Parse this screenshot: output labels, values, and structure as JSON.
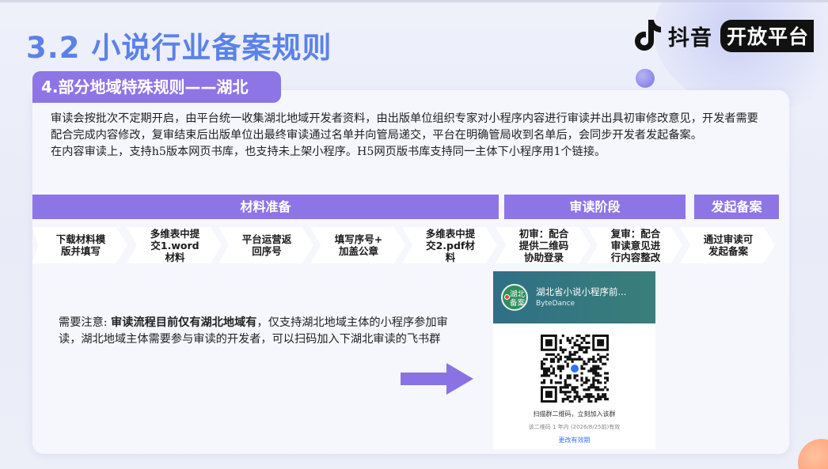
{
  "page": {
    "title": "3.2 小说行业备案规则",
    "brand": "抖音",
    "platform": "开放平台"
  },
  "section": {
    "subtitle": "4.部分地域特殊规则——湖北",
    "intro_line1": "审读会按批次不定期开启，由平台统一收集湖北地域开发者资料，由出版单位组织专家对小程序内容进行审读并出具初审修改意见，开发者需要配合完成内容修改，复审结束后出版单位出最终审读通过名单并向管局递交，平台在明确管局收到名单后，会同步开发者发起备案。",
    "intro_line2": "在内容审读上，支持h5版本网页书库，也支持未上架小程序。H5网页版书库支持同一主体下小程序用1个链接。"
  },
  "phases": [
    {
      "label": "材料准备"
    },
    {
      "label": "审读阶段"
    },
    {
      "label": "发起备案"
    }
  ],
  "steps": [
    {
      "line1": "下载材料模",
      "line2": "版并填写",
      "line3": ""
    },
    {
      "line1": "多维表中提",
      "line2": "交1.word",
      "line3": "材料"
    },
    {
      "line1": "平台运营返",
      "line2": "回序号",
      "line3": ""
    },
    {
      "line1": "填写序号+",
      "line2": "加盖公章",
      "line3": ""
    },
    {
      "line1": "多维表中提",
      "line2": "交2.pdf材",
      "line3": "料"
    },
    {
      "line1": "初审：配合",
      "line2": "提供二维码",
      "line3": "协助登录"
    },
    {
      "line1": "复审：配合",
      "line2": "审读意见进",
      "line3": "行内容整改"
    },
    {
      "line1": "通过审读可",
      "line2": "发起备案",
      "line3": ""
    }
  ],
  "note": {
    "prefix": "需要注意: ",
    "bold": "审读流程目前仅有湖北地域有",
    "rest": "，仅支持湖北地域主体的小程序参加审读，湖北地域主体需要参与审读的开发者，可以扫码加入下湖北审读的飞书群"
  },
  "qr": {
    "avatar_line1": "湖北",
    "avatar_line2": "备案",
    "group_name": "湖北省小说小程序前...",
    "org": "ByteDance",
    "caption": "扫描群二维码，立刻加入该群",
    "validity": "该二维码 1 年内 (2026/8/25前)有效",
    "link": "更改有效期"
  },
  "colors": {
    "accent_purple": "#8e75e6",
    "title_blue": "#5b82e8",
    "arrow_purple": "#8a72e4",
    "qr_header": "#2f6f86"
  }
}
